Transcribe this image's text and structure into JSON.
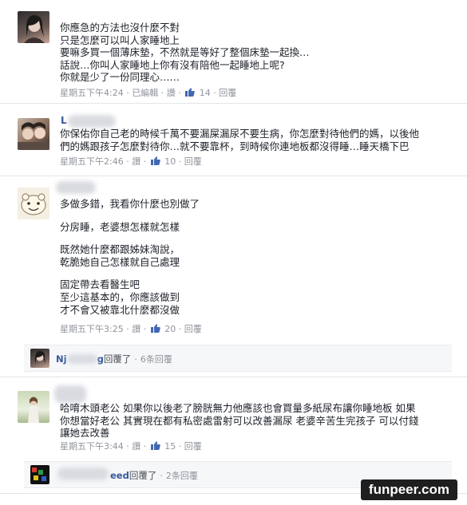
{
  "comments": [
    {
      "lines": [
        "你應急的方法也沒什麼不對",
        "只是怎麼可以叫人家睡地上",
        "要嘛多買一個薄床墊，不然就是等好了整個床墊一起換…",
        "話說…你叫人家睡地上你有沒有陪他一起睡地上呢?",
        "你就是少了一份同理心……"
      ],
      "time": "星期五下午4:24",
      "edited": "已編輯",
      "like": "讚",
      "likes": "14",
      "reply": "回覆"
    },
    {
      "name_fragment": "L",
      "lines": [
        "你保佑你自己老的時候千萬不要漏屎漏尿不要生病，你怎麼對待他們的媽，以後他",
        "們的媽跟孩子怎麼對待你…就不要靠杯，到時候你連地板都沒得睡…睡天橋下巴"
      ],
      "time": "星期五下午2:46",
      "like": "讚",
      "likes": "10",
      "reply": "回覆"
    },
    {
      "lines": [
        "多做多錯，我看你什麼也別做了",
        "",
        "分房睡，老婆想怎樣就怎樣",
        "",
        "既然她什麼都跟姊妹淘說，",
        "乾脆她自己怎樣就自己處理",
        "",
        "固定帶去看醫生吧",
        "至少這基本的，你應該做到",
        "才不會又被靠北什麼都沒做"
      ],
      "time": "星期五下午3:25",
      "like": "讚",
      "likes": "20",
      "reply": "回覆"
    },
    {
      "lines": [
        "哈唷木頭老公 如果你以後老了膀胱無力他應該也會買量多紙尿布讓你睡地板 如果",
        "你想當好老公 其實現在都有私密處雷射可以改善漏尿 老婆辛苦生完孩子 可以付錢",
        "讓她去改善"
      ],
      "time": "星期五下午3:44",
      "like": "讚",
      "likes": "15",
      "reply": "回覆"
    }
  ],
  "reply_bars": [
    {
      "name": "Nj",
      "name_tail": "g",
      "replied": "回覆了",
      "count": "6条回覆"
    },
    {
      "name_tail": "eed",
      "replied": "回覆了",
      "count": "2条回覆"
    }
  ],
  "separator": "·",
  "watermark": "funpeer.com",
  "colors": {
    "link": "#365899",
    "meta": "#90949c",
    "like_blue": "#4267b2"
  }
}
